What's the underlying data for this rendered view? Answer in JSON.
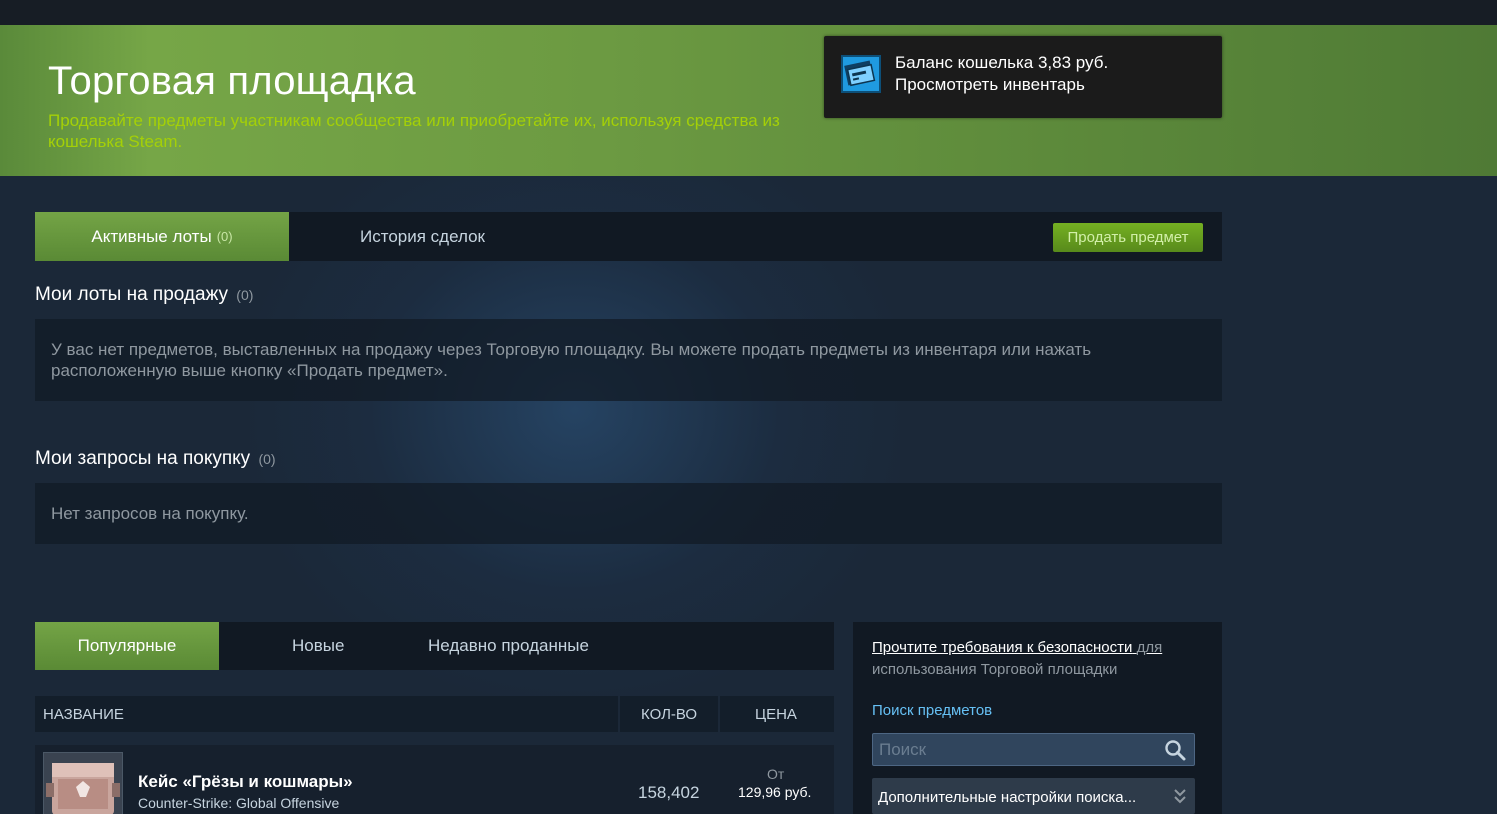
{
  "header": {
    "title": "Торговая площадка",
    "subtitle": "Продавайте предметы участникам сообщества или приобретайте их, используя средства из кошелька Steam."
  },
  "wallet": {
    "balance_text": "Баланс кошелька 3,83 руб.",
    "inventory_link": "Просмотреть инвентарь",
    "icon": "wallet-icon"
  },
  "tabs": {
    "active_label": "Активные лоты",
    "active_count": "(0)",
    "history_label": "История сделок",
    "sell_button": "Продать предмет"
  },
  "my_listings": {
    "title": "Мои лоты на продажу",
    "count": "(0)",
    "empty_text": "У вас нет предметов, выставленных на продажу через Торговую площадку. Вы можете продать предметы из инвентаря или нажать расположенную выше кнопку «Продать предмет»."
  },
  "buy_orders": {
    "title": "Мои запросы на покупку",
    "count": "(0)",
    "empty_text": "Нет запросов на покупку."
  },
  "browse_tabs": [
    "Популярные",
    "Новые",
    "Недавно проданные"
  ],
  "table": {
    "headers": [
      "НАЗВАНИЕ",
      "КОЛ-ВО",
      "ЦЕНА"
    ],
    "rows": [
      {
        "name": "Кейс «Грёзы и кошмары»",
        "game": "Counter-Strike: Global Offensive",
        "quantity": "158,402",
        "price_prefix": "От",
        "price": "129,96 руб."
      }
    ]
  },
  "sidebar": {
    "security_link": "Прочтите требования к безопасности",
    "security_tail": "для",
    "security_line2": "использования Торговой площадки",
    "search_label": "Поиск предметов",
    "search_placeholder": "Поиск",
    "advanced_label": "Дополнительные настройки поиска..."
  },
  "colors": {
    "background": "#1b2838",
    "accent_green": "#74a446",
    "link_blue": "#66c0f4"
  }
}
